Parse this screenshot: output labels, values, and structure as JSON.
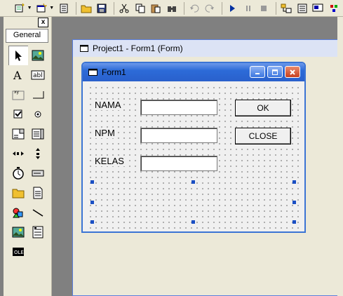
{
  "toolbar": {
    "buttons": [
      "add-project",
      "add-form",
      "menu-editor",
      "open",
      "save",
      "cut",
      "copy",
      "paste",
      "find",
      "undo",
      "redo",
      "start",
      "break",
      "end",
      "project-explorer",
      "properties",
      "form-layout",
      "object-browser"
    ]
  },
  "toolbox": {
    "tab_label": "General",
    "close_label": "x",
    "tools": [
      "pointer",
      "picturebox",
      "label",
      "textbox",
      "frame",
      "commandbutton",
      "checkbox",
      "optionbutton",
      "combobox",
      "listbox",
      "hscrollbar",
      "vscrollbar",
      "timer",
      "drivelistbox",
      "dirlistbox",
      "filelistbox",
      "shape",
      "line",
      "image",
      "data",
      "ole"
    ]
  },
  "mdi_window": {
    "title": "Project1 - Form1 (Form)"
  },
  "form": {
    "title": "Form1",
    "labels": {
      "nama": "NAMA",
      "npm": "NPM",
      "kelas": "KELAS"
    },
    "buttons": {
      "ok": "OK",
      "close": "CLOSE"
    }
  }
}
